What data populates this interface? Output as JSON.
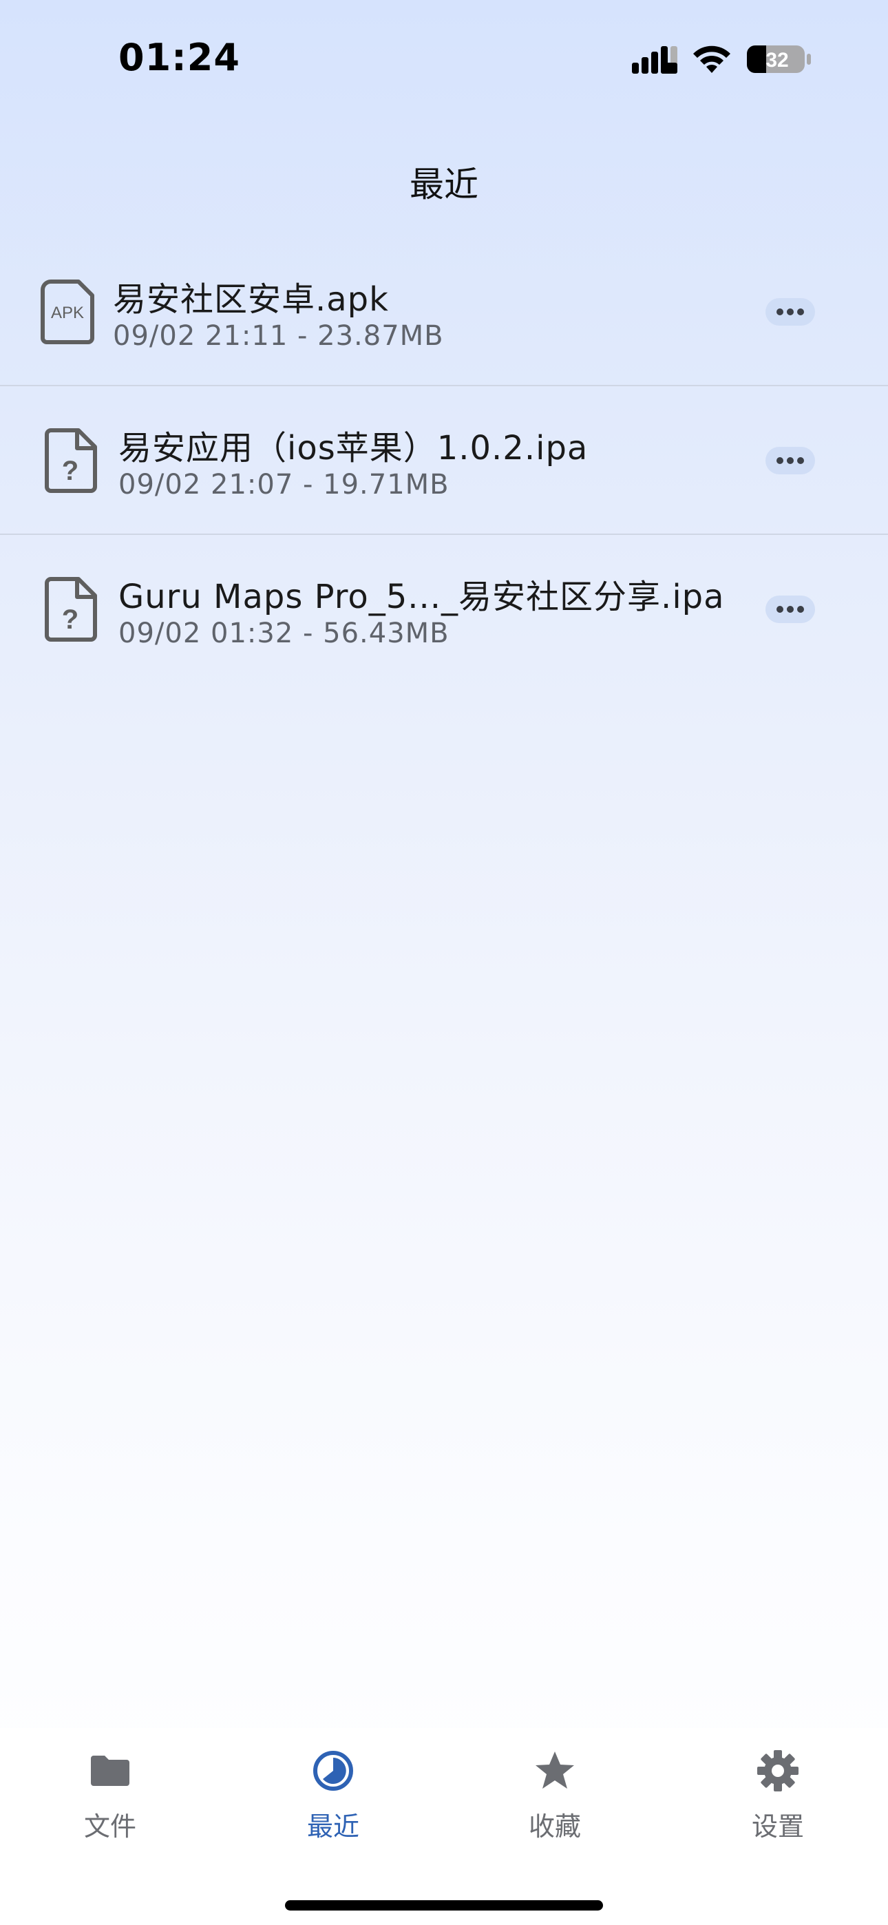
{
  "status_bar": {
    "time": "01:24",
    "battery_level": "32",
    "icons": [
      "signal-icon",
      "wifi-icon",
      "battery-icon"
    ]
  },
  "header": {
    "title": "最近"
  },
  "files": [
    {
      "icon": "apk-file-icon",
      "icon_label": "APK",
      "name": "易安社区安卓.apk",
      "date": "09/02 21:11",
      "separator": "-",
      "size": "23.87MB"
    },
    {
      "icon": "unknown-file-icon",
      "icon_label": "?",
      "name": "易安应用（ios苹果）1.0.2.ipa",
      "date": "09/02 21:07",
      "separator": "-",
      "size": "19.71MB"
    },
    {
      "icon": "unknown-file-icon",
      "icon_label": "?",
      "name": "Guru Maps Pro_5..._易安社区分享.ipa",
      "date": "09/02 01:32",
      "separator": "-",
      "size": "56.43MB"
    }
  ],
  "tabs": [
    {
      "label": "文件",
      "icon": "folder-icon",
      "active": false
    },
    {
      "label": "最近",
      "icon": "clock-icon",
      "active": true
    },
    {
      "label": "收藏",
      "icon": "star-icon",
      "active": false
    },
    {
      "label": "设置",
      "icon": "gear-icon",
      "active": false
    }
  ],
  "colors": {
    "accent": "#2e62b4",
    "inactive_tab": "#6b6d72",
    "file_icon": "#5f5f5f"
  }
}
